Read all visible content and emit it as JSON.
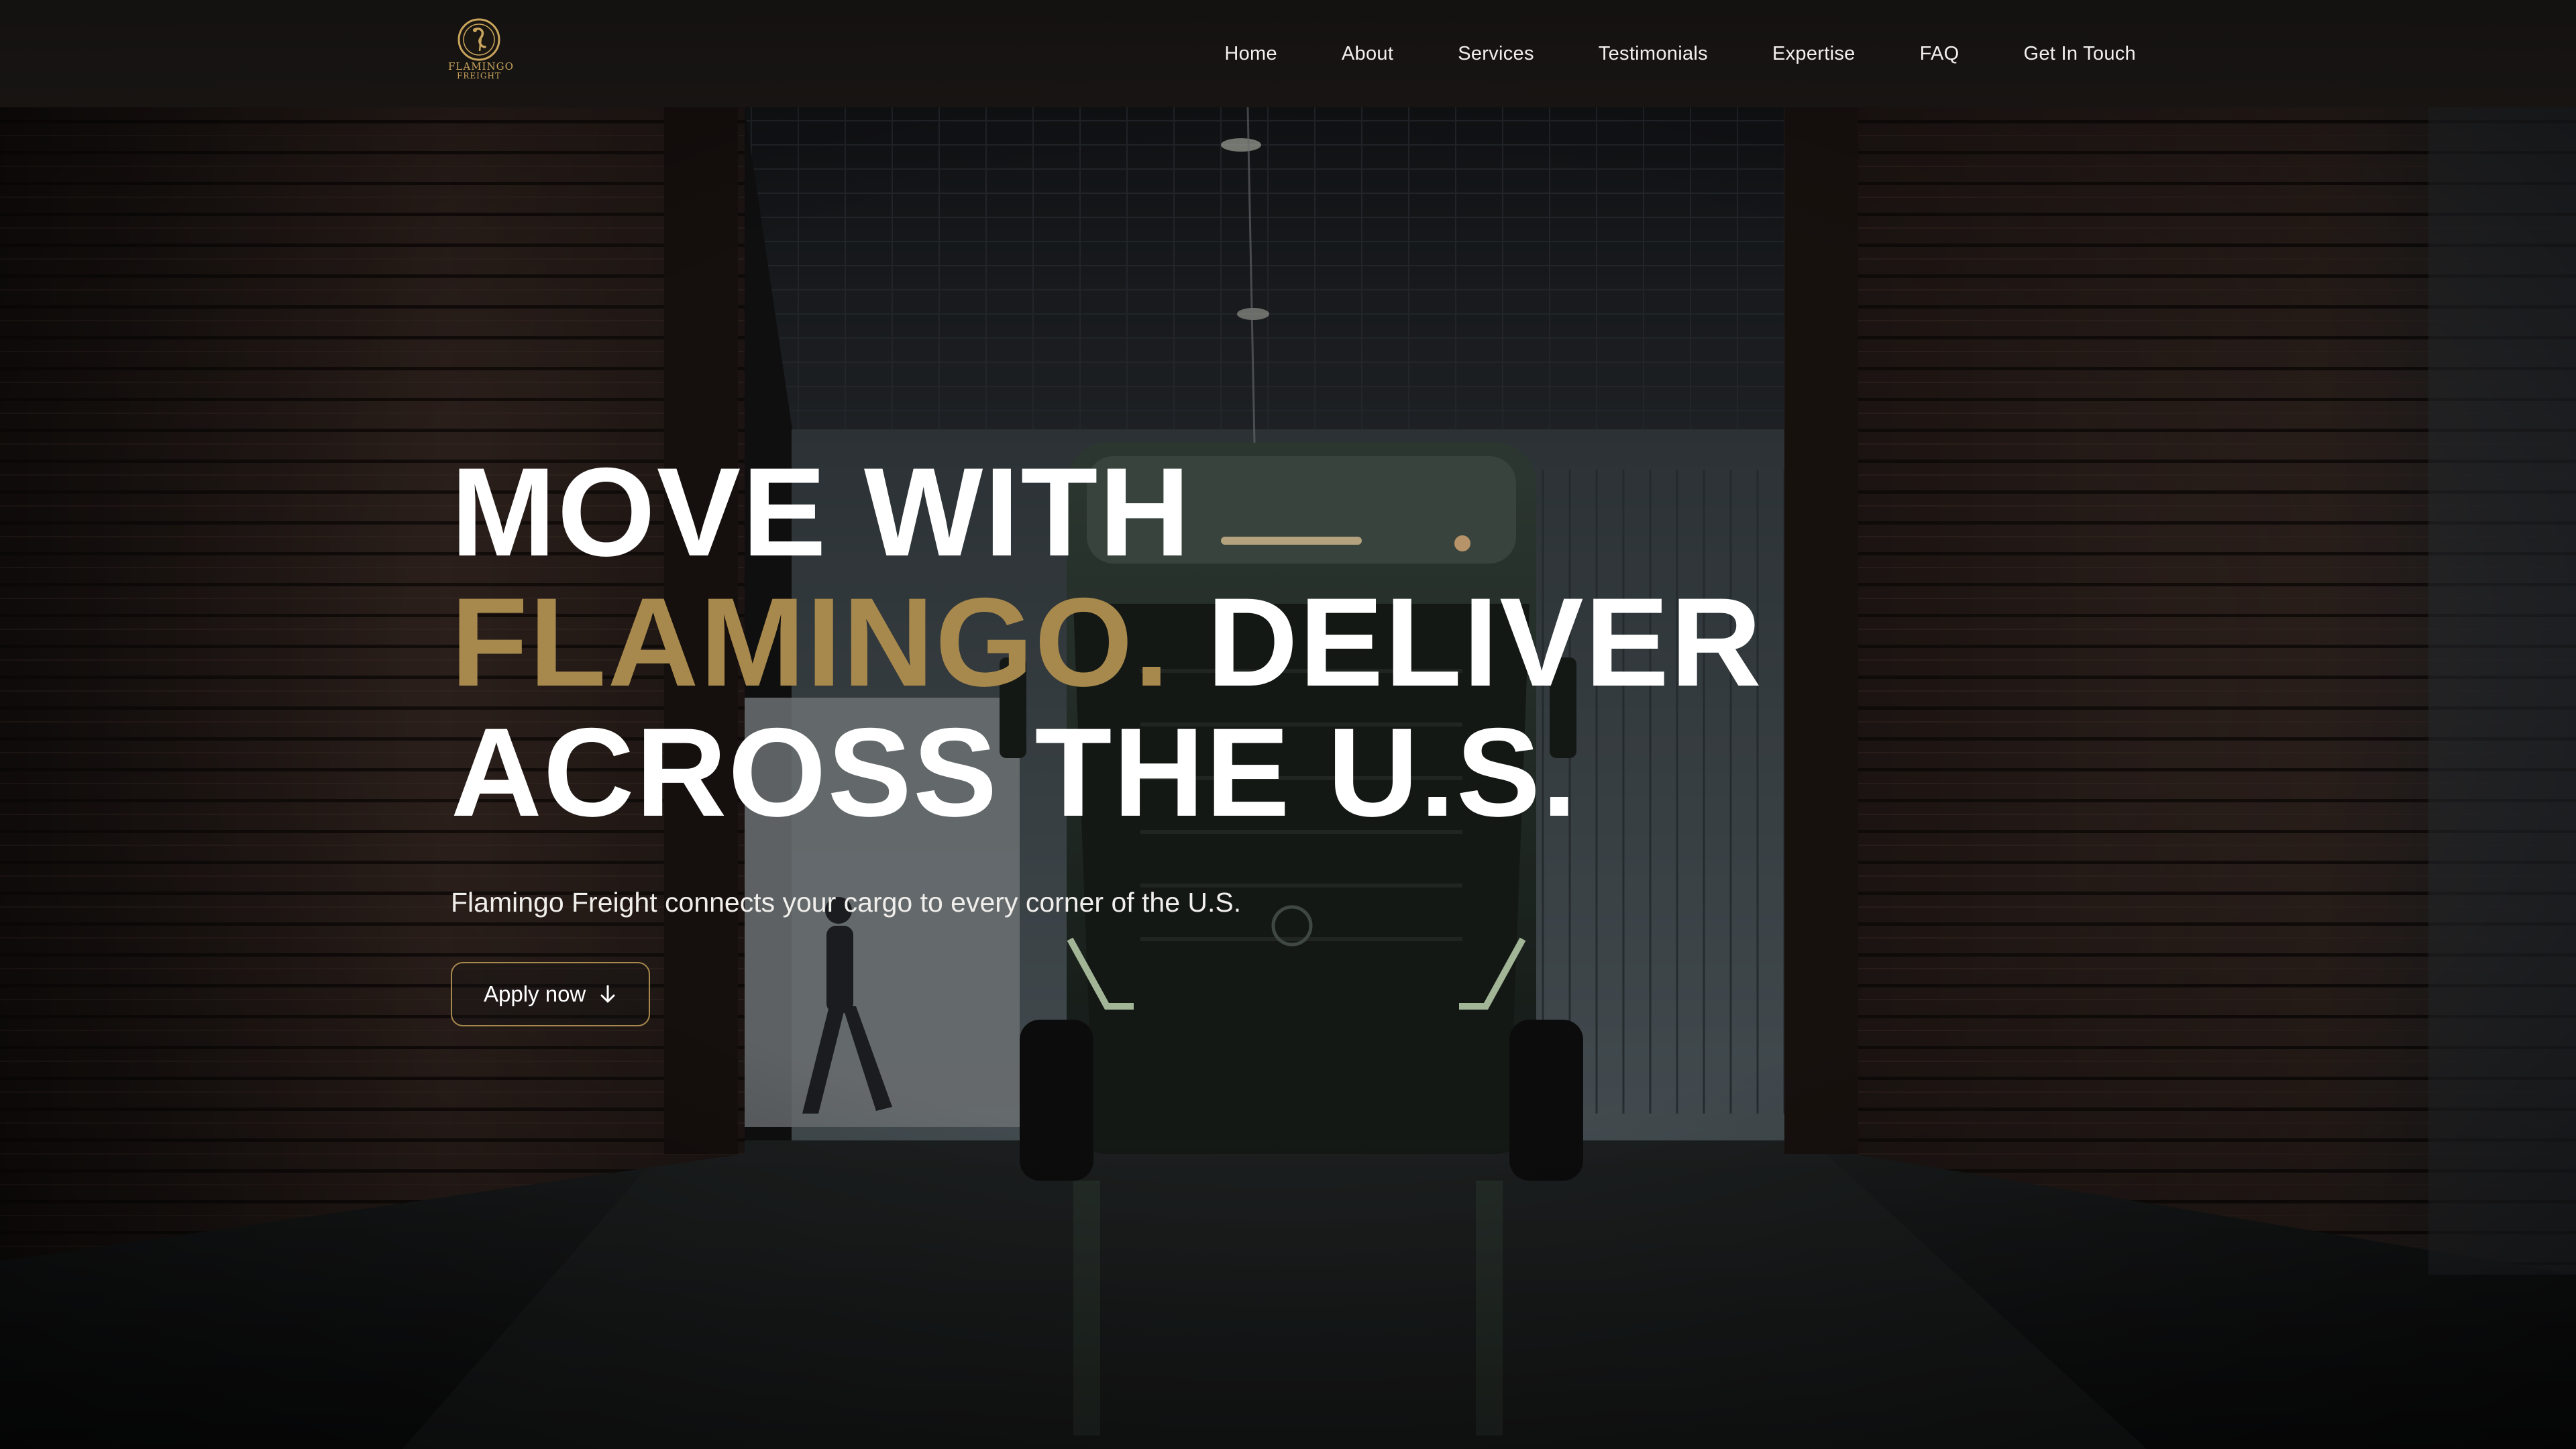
{
  "brand": {
    "name_line1": "FLAMINGO",
    "name_line2": "FREIGHT",
    "logo_icon": "flamingo-emblem-icon",
    "accent_color": "#a8894d"
  },
  "nav": {
    "items": [
      "Home",
      "About",
      "Services",
      "Testimonials",
      "Expertise",
      "FAQ",
      "Get In Touch"
    ]
  },
  "hero": {
    "headline_line1": "MOVE WITH",
    "headline_accent": "FLAMINGO.",
    "headline_line2_rest": " DELIVER",
    "headline_line3": "ACROSS THE U.S.",
    "subtitle": "Flamingo Freight connects your cargo to every corner of the U.S.",
    "cta_label": "Apply now",
    "cta_icon": "arrow-down-icon"
  },
  "colors": {
    "background": "#0d0d0f",
    "nav_background": "#151414",
    "text": "#ffffff",
    "accent": "#a8894d"
  }
}
